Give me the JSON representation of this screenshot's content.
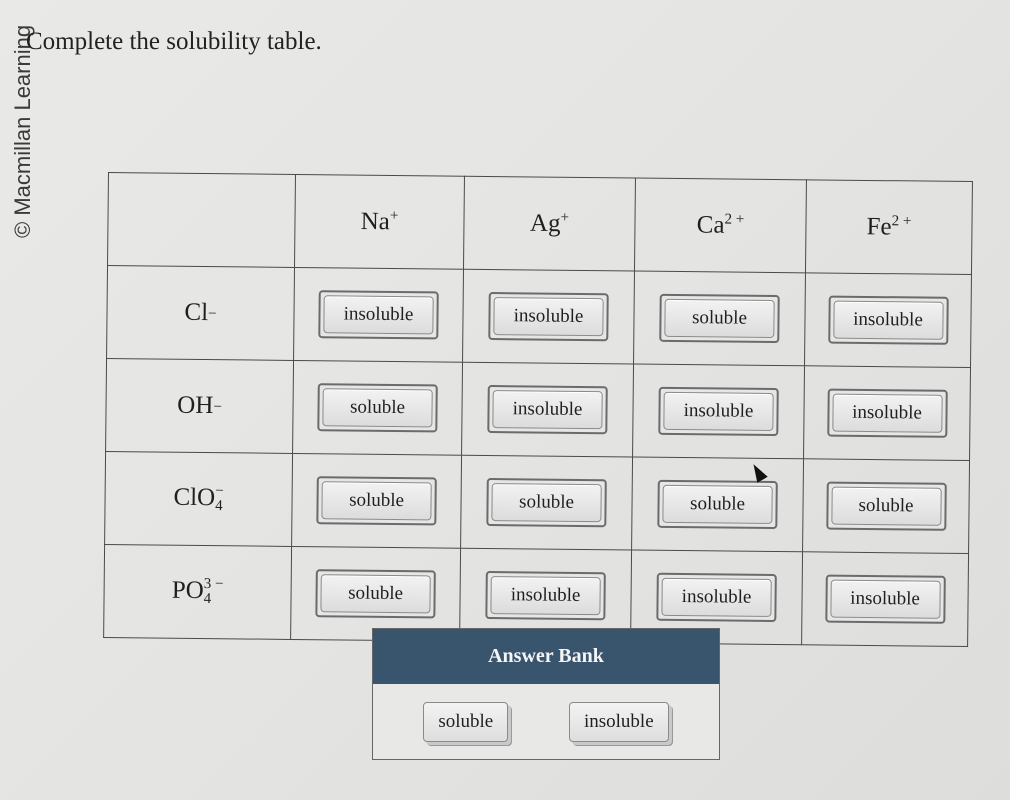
{
  "copyright": "© Macmillan Learning",
  "instructions": "Complete the solubility table.",
  "table": {
    "cations": [
      {
        "symbol": "Na",
        "charge": "+"
      },
      {
        "symbol": "Ag",
        "charge": "+"
      },
      {
        "symbol": "Ca",
        "charge": "2 +"
      },
      {
        "symbol": "Fe",
        "charge": "2 +"
      }
    ],
    "anions": [
      {
        "symbol": "Cl",
        "subscript": "",
        "charge": "−"
      },
      {
        "symbol": "OH",
        "subscript": "",
        "charge": "−"
      },
      {
        "symbol": "ClO",
        "subscript": "4",
        "charge": "−"
      },
      {
        "symbol": "PO",
        "subscript": "4",
        "charge": "3 −"
      }
    ],
    "rows": [
      [
        "insoluble",
        "insoluble",
        "soluble",
        "insoluble"
      ],
      [
        "soluble",
        "insoluble",
        "insoluble",
        "insoluble"
      ],
      [
        "soluble",
        "soluble",
        "soluble",
        "soluble"
      ],
      [
        "soluble",
        "insoluble",
        "insoluble",
        "insoluble"
      ]
    ]
  },
  "answer_bank": {
    "title": "Answer Bank",
    "options": [
      "soluble",
      "insoluble"
    ]
  }
}
